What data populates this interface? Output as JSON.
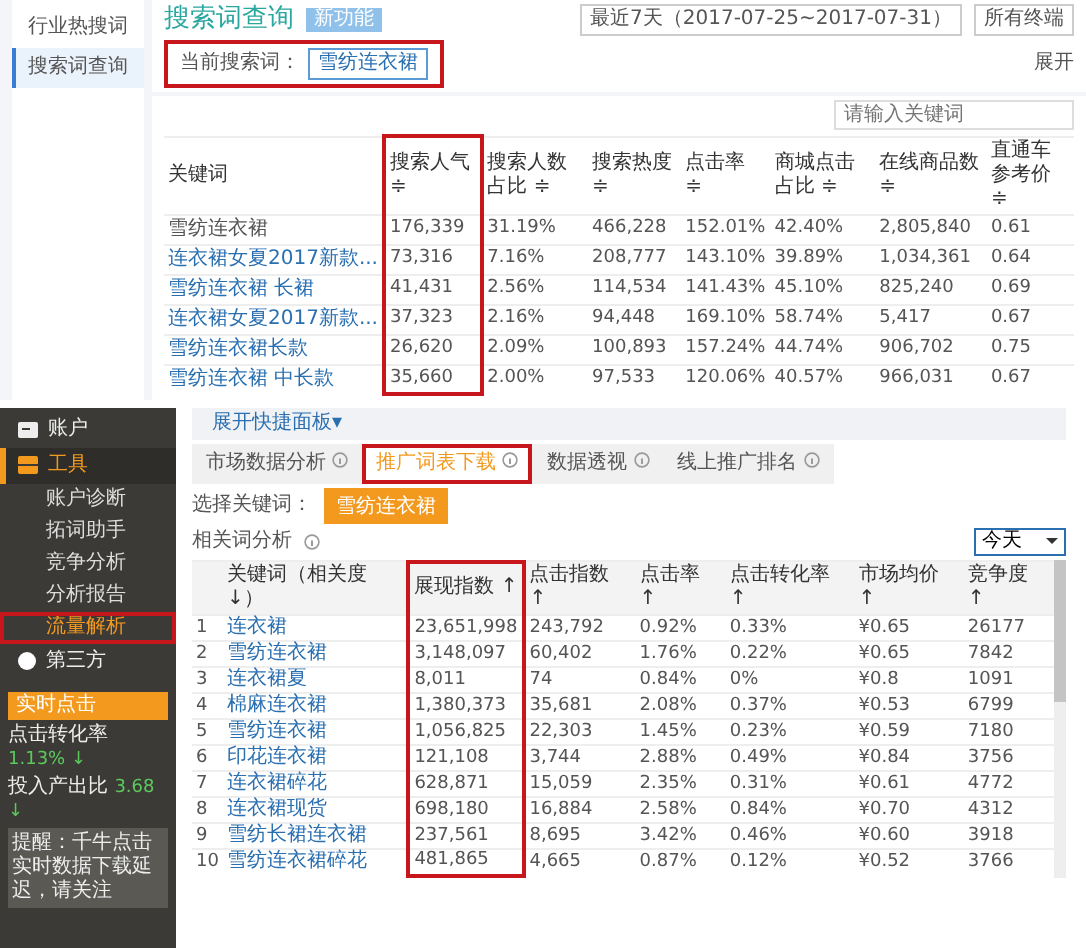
{
  "top": {
    "sidebar": [
      {
        "label": "行业热搜词",
        "selected": false
      },
      {
        "label": "搜索词查询",
        "selected": true
      }
    ],
    "title": "搜索词查询",
    "badge": "新功能",
    "date_range": "最近7天（2017-07-25~2017-07-31）",
    "terminal": "所有终端",
    "current_term": {
      "label": "当前搜索词：",
      "value": "雪纺连衣裙",
      "highlighted": true
    },
    "expand": "展开",
    "search": {
      "placeholder": "请输入关键词"
    },
    "table": {
      "columns": [
        {
          "label": "关键词",
          "highlighted": false
        },
        {
          "label": "搜索人气 ≑",
          "highlighted": true
        },
        {
          "label": "搜索人数占比 ≑",
          "highlighted": false
        },
        {
          "label": "搜索热度 ≑",
          "highlighted": false
        },
        {
          "label": "点击率 ≑",
          "highlighted": false
        },
        {
          "label": "商城点击占比 ≑",
          "highlighted": false
        },
        {
          "label": "在线商品数 ≑",
          "highlighted": false
        },
        {
          "label": "直通车参考价 ≑",
          "highlighted": false
        }
      ],
      "rows": [
        {
          "linked": false,
          "cells": [
            "雪纺连衣裙",
            "176,339",
            "31.19%",
            "466,228",
            "152.01%",
            "42.40%",
            "2,805,840",
            "0.61"
          ]
        },
        {
          "linked": true,
          "cells": [
            "连衣裙女夏2017新款...",
            "73,316",
            "7.16%",
            "208,777",
            "143.10%",
            "39.89%",
            "1,034,361",
            "0.64"
          ]
        },
        {
          "linked": true,
          "cells": [
            "雪纺连衣裙 长裙",
            "41,431",
            "2.56%",
            "114,534",
            "141.43%",
            "45.10%",
            "825,240",
            "0.69"
          ]
        },
        {
          "linked": true,
          "cells": [
            "连衣裙女夏2017新款...",
            "37,323",
            "2.16%",
            "94,448",
            "169.10%",
            "58.74%",
            "5,417",
            "0.67"
          ]
        },
        {
          "linked": true,
          "cells": [
            "雪纺连衣裙长款",
            "26,620",
            "2.09%",
            "100,893",
            "157.24%",
            "44.74%",
            "906,702",
            "0.75"
          ]
        },
        {
          "linked": true,
          "cells": [
            "雪纺连衣裙 中长款",
            "35,660",
            "2.00%",
            "97,533",
            "120.06%",
            "40.57%",
            "966,031",
            "0.67"
          ]
        }
      ]
    }
  },
  "bottom": {
    "sidebar": {
      "items": [
        {
          "label": "账户",
          "kind": "section",
          "selected": false,
          "highlighted": false
        },
        {
          "label": "工具",
          "kind": "section",
          "selected": true,
          "highlighted": false
        },
        {
          "label": "账户诊断",
          "kind": "sub",
          "selected": false,
          "highlighted": false
        },
        {
          "label": "拓词助手",
          "kind": "sub",
          "selected": false,
          "highlighted": false
        },
        {
          "label": "竞争分析",
          "kind": "sub",
          "selected": false,
          "highlighted": false
        },
        {
          "label": "分析报告",
          "kind": "sub",
          "selected": false,
          "highlighted": false
        },
        {
          "label": "流量解析",
          "kind": "sub",
          "selected": true,
          "highlighted": true
        },
        {
          "label": "第三方",
          "kind": "third",
          "selected": false,
          "highlighted": false
        }
      ],
      "realtime": {
        "title": "实时点击",
        "stats": [
          {
            "label": "点击转化率",
            "value": "1.13% ↓"
          },
          {
            "label": "投入产出比",
            "value": "3.68 ↓"
          }
        ]
      },
      "notice": "提醒：千牛点击实时数据下载延迟，请关注"
    },
    "quick_panel": "展开快捷面板▾",
    "tabs": [
      {
        "label": "市场数据分析",
        "selected": false,
        "highlighted": false
      },
      {
        "label": "推广词表下载",
        "selected": true,
        "highlighted": true
      },
      {
        "label": "数据透视",
        "selected": false,
        "highlighted": false
      },
      {
        "label": "线上推广排名",
        "selected": false,
        "highlighted": false
      }
    ],
    "keyword_label": "选择关键词：",
    "keyword": "雪纺连衣裙",
    "related_title": "相关词分析",
    "period": "今天",
    "table": {
      "columns": [
        {
          "label": "关键词（相关度↓）",
          "highlighted": false
        },
        {
          "label": "展现指数 ↑",
          "highlighted": true
        },
        {
          "label": "点击指数 ↑",
          "highlighted": false
        },
        {
          "label": "点击率 ↑",
          "highlighted": false
        },
        {
          "label": "点击转化率 ↑",
          "highlighted": false
        },
        {
          "label": "市场均价 ↑",
          "highlighted": false
        },
        {
          "label": "竞争度 ↑",
          "highlighted": false
        }
      ],
      "rows": [
        {
          "rank": "1",
          "cells": [
            "连衣裙",
            "23,651,998",
            "243,792",
            "0.92%",
            "0.33%",
            "¥0.65",
            "26177"
          ]
        },
        {
          "rank": "2",
          "cells": [
            "雪纺连衣裙",
            "3,148,097",
            "60,402",
            "1.76%",
            "0.22%",
            "¥0.65",
            "7842"
          ]
        },
        {
          "rank": "3",
          "cells": [
            "连衣裙夏",
            "8,011",
            "74",
            "0.84%",
            "0%",
            "¥0.8",
            "1091"
          ]
        },
        {
          "rank": "4",
          "cells": [
            "棉麻连衣裙",
            "1,380,373",
            "35,681",
            "2.08%",
            "0.37%",
            "¥0.53",
            "6799"
          ]
        },
        {
          "rank": "5",
          "cells": [
            "雪纺连衣裙",
            "1,056,825",
            "22,303",
            "1.45%",
            "0.23%",
            "¥0.59",
            "7180"
          ]
        },
        {
          "rank": "6",
          "cells": [
            "印花连衣裙",
            "121,108",
            "3,744",
            "2.88%",
            "0.49%",
            "¥0.84",
            "3756"
          ]
        },
        {
          "rank": "7",
          "cells": [
            "连衣裙碎花",
            "628,871",
            "15,059",
            "2.35%",
            "0.31%",
            "¥0.61",
            "4772"
          ]
        },
        {
          "rank": "8",
          "cells": [
            "连衣裙现货",
            "698,180",
            "16,884",
            "2.58%",
            "0.84%",
            "¥0.70",
            "4312"
          ]
        },
        {
          "rank": "9",
          "cells": [
            "雪纺长裙连衣裙",
            "237,561",
            "8,695",
            "3.42%",
            "0.46%",
            "¥0.60",
            "3918"
          ]
        },
        {
          "rank": "10",
          "cells": [
            "雪纺连衣裙碎花",
            "481,865",
            "4,665",
            "0.87%",
            "0.12%",
            "¥0.52",
            "3766"
          ]
        }
      ]
    }
  }
}
